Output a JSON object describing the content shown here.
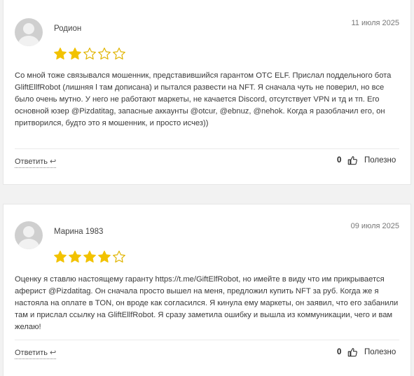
{
  "reviews": [
    {
      "author": "Родион",
      "date": "11 июля 2025",
      "rating": 2,
      "max_rating": 5,
      "text": "Со мной тоже связывался мошенник, представившийся гарантом OTC ELF. Прислал поддельного бота GliftEllfRobot (лишняя l там дописана) и пытался развести на NFT. Я сначала чуть не поверил, но все было очень мутно. У него не работают маркеты, не качается Discord, отсутствует VPN и тд и тп. Его основной юзер @Pizdatitag, запасные аккаунты @otcur, @ebnuz, @nehok. Когда я разоблачил его, он притворился, будто это я мошенник, и просто исчез))",
      "reply_label": "Ответить",
      "likes": "0",
      "useful_label": "Полезно"
    },
    {
      "author": "Марина 1983",
      "date": "09 июля 2025",
      "rating": 4,
      "max_rating": 5,
      "text": "Оценку я ставлю настоящему гаранту https://t.me/GiftElfRobot, но имейте в виду что им прикрывается аферист @Pizdatitag. Он сначала просто вышел на меня, предложил купить NFT за руб. Когда же я настояла на оплате в TON, он вроде как согласился. Я кинула ему маркеты, он заявил, что его забанили там и прислал ссылку на GliftEllfRobot. Я сразу заметила ошибку и вышла из коммуникации, чего и вам желаю!",
      "reply_label": "Ответить",
      "likes": "0",
      "useful_label": "Полезно"
    }
  ],
  "colors": {
    "star_filled": "#f2c200",
    "star_empty": "#e0b400",
    "background": "#f2f2f2"
  },
  "icons": {
    "reply": "reply-arrow-icon",
    "like": "thumbs-up-icon",
    "avatar": "user-avatar-icon",
    "star": "star-icon"
  }
}
